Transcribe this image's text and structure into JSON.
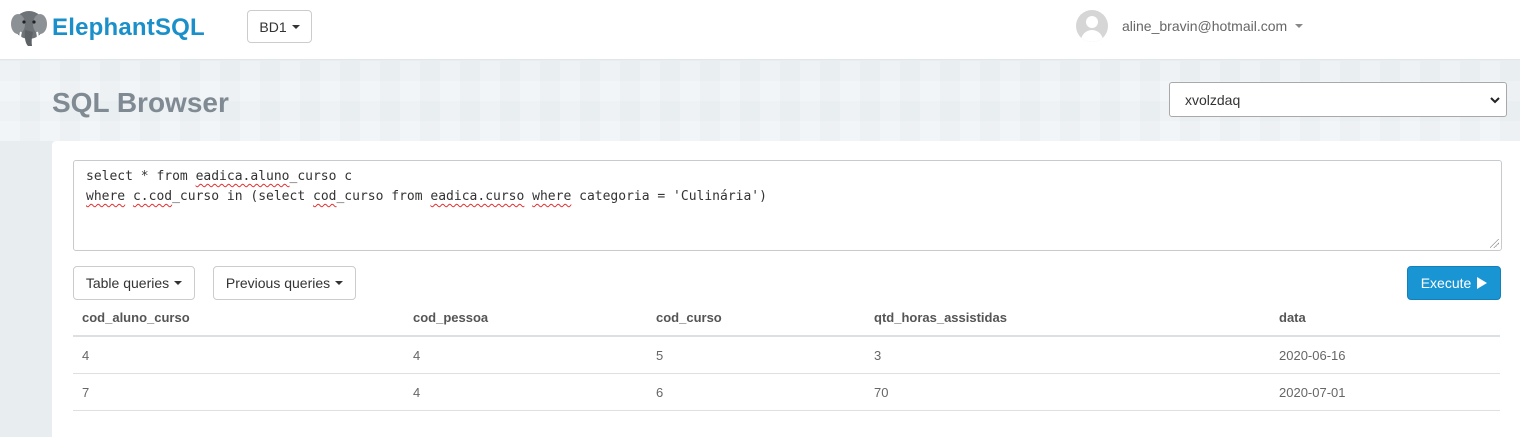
{
  "app": {
    "brand": "ElephantSQL",
    "database_selector": "BD1",
    "user_email": "aline_bravin@hotmail.com"
  },
  "page": {
    "title": "SQL Browser",
    "instance_selected": "xvolzdaq"
  },
  "query": {
    "line1": {
      "a": "select * from ",
      "b": "eadica.aluno",
      "c": "_curso c"
    },
    "line2": {
      "a": "where",
      "b": " ",
      "c": "c.cod",
      "d": "_curso in (select ",
      "e": "cod",
      "f": "_curso from ",
      "g": "eadica.curso",
      "h": " ",
      "i": "where",
      "j": " categoria = 'Culinária')"
    }
  },
  "toolbar": {
    "table_queries": "Table queries",
    "previous_queries": "Previous queries",
    "execute": "Execute"
  },
  "results": {
    "columns": [
      "cod_aluno_curso",
      "cod_pessoa",
      "cod_curso",
      "qtd_horas_assistidas",
      "data"
    ],
    "rows": [
      [
        "4",
        "4",
        "5",
        "3",
        "2020-06-16"
      ],
      [
        "7",
        "4",
        "6",
        "70",
        "2020-07-01"
      ]
    ]
  },
  "colors": {
    "brand": "#1a8fc9",
    "execute_button": "#1a95d4",
    "page_background": "#e8edf0"
  },
  "icons": {
    "logo": "elephant-logo-icon",
    "avatar": "user-avatar-icon",
    "execute": "play-icon"
  }
}
